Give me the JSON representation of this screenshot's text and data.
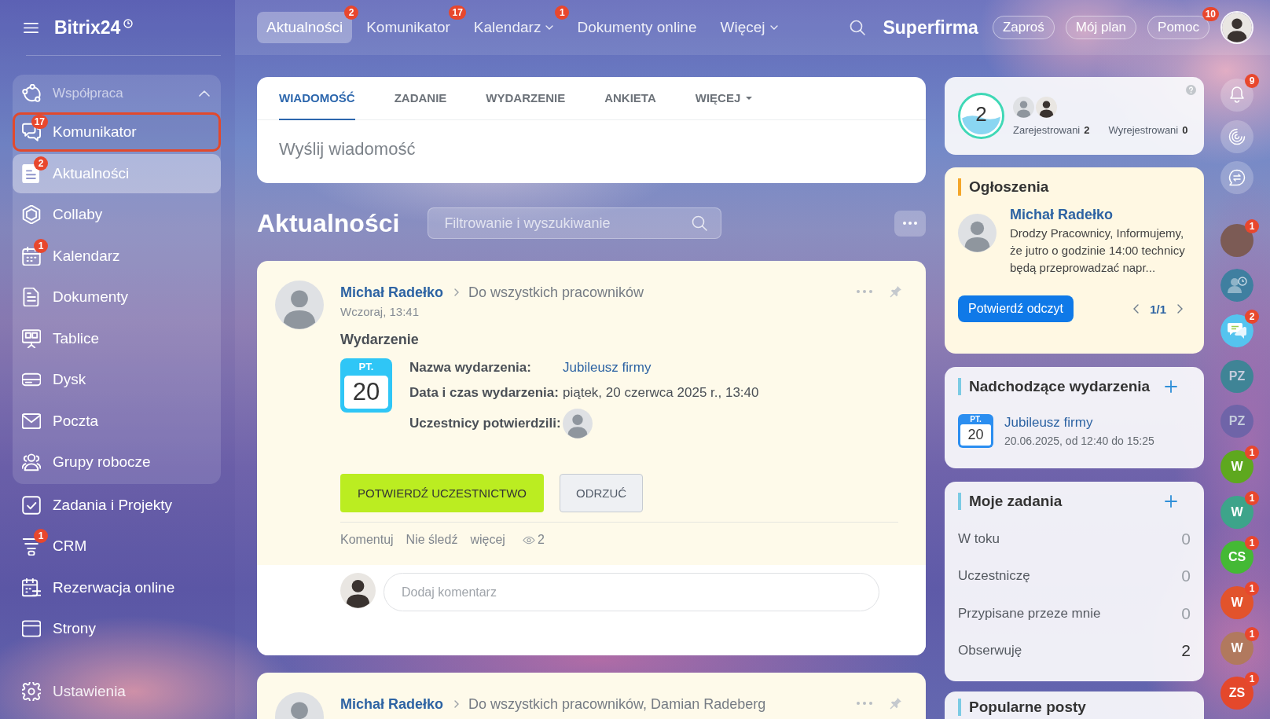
{
  "sidebar": {
    "logo": "Bitrix24",
    "group": {
      "label": "Współpraca",
      "expanded": true,
      "items": [
        {
          "label": "Komunikator",
          "badge": "17",
          "selected": false,
          "outlined": true
        },
        {
          "label": "Aktualności",
          "badge": "2",
          "selected": true,
          "outlined": false
        },
        {
          "label": "Collaby",
          "selected": false,
          "outlined": false
        },
        {
          "label": "Kalendarz",
          "badge": "1",
          "selected": false,
          "outlined": false
        },
        {
          "label": "Dokumenty",
          "selected": false,
          "outlined": false
        },
        {
          "label": "Tablice",
          "selected": false,
          "outlined": false
        },
        {
          "label": "Dysk",
          "selected": false,
          "outlined": false
        },
        {
          "label": "Poczta",
          "selected": false,
          "outlined": false
        },
        {
          "label": "Grupy robocze",
          "selected": false,
          "outlined": false
        }
      ]
    },
    "items": [
      {
        "label": "Zadania i Projekty",
        "selected": false,
        "outlined": false
      },
      {
        "label": "CRM",
        "badge": "1",
        "selected": false,
        "outlined": false
      },
      {
        "label": "Rezerwacja online",
        "selected": false,
        "outlined": false
      },
      {
        "label": "Strony",
        "selected": false,
        "outlined": false
      }
    ],
    "settings": "Ustawienia"
  },
  "top_nav": [
    {
      "label": "Aktualności",
      "badge": "2",
      "dropdown": false,
      "selected": true
    },
    {
      "label": "Komunikator",
      "badge": "17",
      "dropdown": false,
      "selected": false
    },
    {
      "label": "Kalendarz",
      "badge": "1",
      "dropdown": true,
      "selected": false
    },
    {
      "label": "Dokumenty online",
      "dropdown": false,
      "selected": false
    },
    {
      "label": "Więcej",
      "dropdown": true,
      "selected": false
    }
  ],
  "header": {
    "company": "Superfirma",
    "buttons": [
      {
        "label": "Zaproś"
      },
      {
        "label": "Mój plan"
      },
      {
        "label": "Pomoc",
        "badge": "10"
      }
    ]
  },
  "composer": {
    "tabs": [
      {
        "label": "WIADOMOŚĆ",
        "dropdown": false,
        "selected": true
      },
      {
        "label": "ZADANIE",
        "dropdown": false,
        "selected": false
      },
      {
        "label": "WYDARZENIE",
        "dropdown": false,
        "selected": false
      },
      {
        "label": "ANKIETA",
        "dropdown": false,
        "selected": false
      },
      {
        "label": "WIĘCEJ",
        "dropdown": true,
        "selected": false
      }
    ],
    "placeholder": "Wyślij wiadomość"
  },
  "feed": {
    "title": "Aktualności",
    "filter_placeholder": "Filtrowanie i wyszukiwanie",
    "posts": [
      {
        "author": "Michał Radełko",
        "recipients": "Do wszystkich pracowników",
        "time": "Wczoraj, 13:41",
        "event": {
          "label": "Wydarzenie",
          "weekday": "PT.",
          "day": "20",
          "fields": [
            {
              "label": "Nazwa wydarzenia:",
              "kind": "link",
              "value": "Jubileusz firmy"
            },
            {
              "label": "Data i czas wydarzenia:",
              "kind": "text",
              "value": "piątek, 20 czerwca 2025 r., 13:40"
            },
            {
              "label": "Uczestnicy potwierdzili:",
              "kind": "avatars"
            }
          ],
          "buttons": [
            {
              "label": "POTWIERDŹ UCZESTNICTWO",
              "kind": "primary"
            },
            {
              "label": "ODRZUĆ",
              "kind": "secondary"
            }
          ]
        },
        "actions": [
          "Komentuj",
          "Nie śledź",
          "więcej"
        ],
        "views": "2",
        "comment_placeholder": "Dodaj komentarz"
      },
      {
        "author": "Michał Radełko",
        "recipients": "Do wszystkich pracowników, Damian Radeberg"
      }
    ]
  },
  "widgets": {
    "attendance": {
      "count": "2",
      "stats": [
        {
          "label": "Zarejestrowani",
          "value": "2"
        },
        {
          "label": "Wyrejestrowani",
          "value": "0"
        }
      ]
    },
    "announcements": {
      "title": "Ogłoszenia",
      "author": "Michał Radełko",
      "text": "Drodzy Pracownicy, Informujemy, że jutro o godzinie 14:00 technicy będą przeprowadzać napr...",
      "button": "Potwierdź odczyt",
      "pager": "1/1"
    },
    "upcoming": {
      "title": "Nadchodzące wydarzenia",
      "events": [
        {
          "weekday": "PT.",
          "day": "20",
          "title": "Jubileusz firmy",
          "time": "20.06.2025, od 12:40 do 15:25"
        }
      ]
    },
    "tasks": {
      "title": "Moje zadania",
      "rows": [
        {
          "label": "W toku",
          "count": "0",
          "highlighted": false
        },
        {
          "label": "Uczestniczę",
          "count": "0",
          "highlighted": false
        },
        {
          "label": "Przypisane przeze mnie",
          "count": "0",
          "highlighted": false
        },
        {
          "label": "Obserwuję",
          "count": "2",
          "highlighted": true
        }
      ]
    },
    "popular": {
      "title": "Popularne posty"
    }
  },
  "right_bar": {
    "bell_badge": "9",
    "chats": [
      {
        "kind": "photo",
        "badge": "1"
      },
      {
        "kind": "contact"
      },
      {
        "kind": "chat",
        "badge": "2"
      },
      {
        "kind": "initials",
        "initials": "PZ",
        "color": "#3f8496",
        "muted": true
      },
      {
        "kind": "initials",
        "initials": "PZ",
        "color": "#6f64a8",
        "muted": true
      },
      {
        "kind": "initials",
        "initials": "W",
        "color": "#5ea81e",
        "badge": "1",
        "muted": false
      },
      {
        "kind": "initials",
        "initials": "W",
        "color": "#3da48a",
        "badge": "1",
        "muted": false
      },
      {
        "kind": "initials",
        "initials": "CS",
        "color": "#44b935",
        "badge": "1",
        "muted": false
      },
      {
        "kind": "initials",
        "initials": "W",
        "color": "#e2532c",
        "badge": "1",
        "muted": false
      },
      {
        "kind": "initials",
        "initials": "W",
        "color": "#b1795e",
        "badge": "1",
        "muted": false
      },
      {
        "kind": "initials",
        "initials": "ZS",
        "color": "#e4482b",
        "badge": "1",
        "muted": false
      }
    ]
  }
}
